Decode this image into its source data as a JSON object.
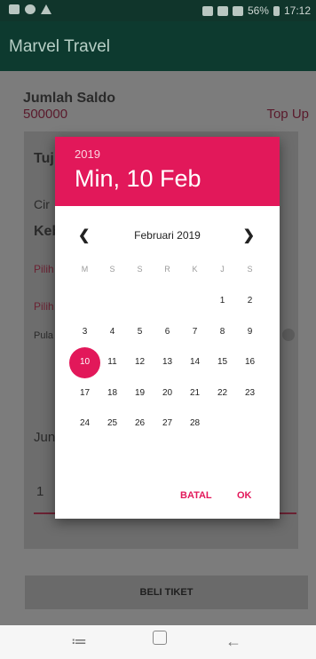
{
  "status_bar": {
    "battery": "56%",
    "time": "17:12"
  },
  "app_bar": {
    "title": "Marvel Travel"
  },
  "content": {
    "saldo_label": "Jumlah Saldo",
    "saldo_value": "500000",
    "topup_label": "Top Up",
    "tujuan_partial": "Tuj",
    "city_partial": "Cir",
    "keb_partial": "Keb",
    "pilih1_partial": "Pilih",
    "pilih2_partial": "Pilih",
    "pulang_partial": "Pula",
    "jumlah_partial": "Jun",
    "jumlah_input_value": "1",
    "beli_button": "BELI TIKET"
  },
  "dialog": {
    "year": "2019",
    "date": "Min, 10 Feb",
    "month_label": "Februari 2019",
    "prev_icon": "chevron-left-icon",
    "next_icon": "chevron-right-icon",
    "weekdays": [
      "M",
      "S",
      "S",
      "R",
      "K",
      "J",
      "S"
    ],
    "weeks": [
      [
        "",
        "",
        "",
        "",
        "",
        "1",
        "2"
      ],
      [
        "3",
        "4",
        "5",
        "6",
        "7",
        "8",
        "9"
      ],
      [
        "10",
        "11",
        "12",
        "13",
        "14",
        "15",
        "16"
      ],
      [
        "17",
        "18",
        "19",
        "20",
        "21",
        "22",
        "23"
      ],
      [
        "24",
        "25",
        "26",
        "27",
        "28",
        "",
        ""
      ]
    ],
    "selected_day": "10",
    "cancel_label": "BATAL",
    "ok_label": "OK",
    "accent_color": "#E2185A"
  },
  "nav_bar": {
    "recent_icon": "recent-apps-icon",
    "home_icon": "home-icon",
    "back_icon": "back-icon"
  }
}
